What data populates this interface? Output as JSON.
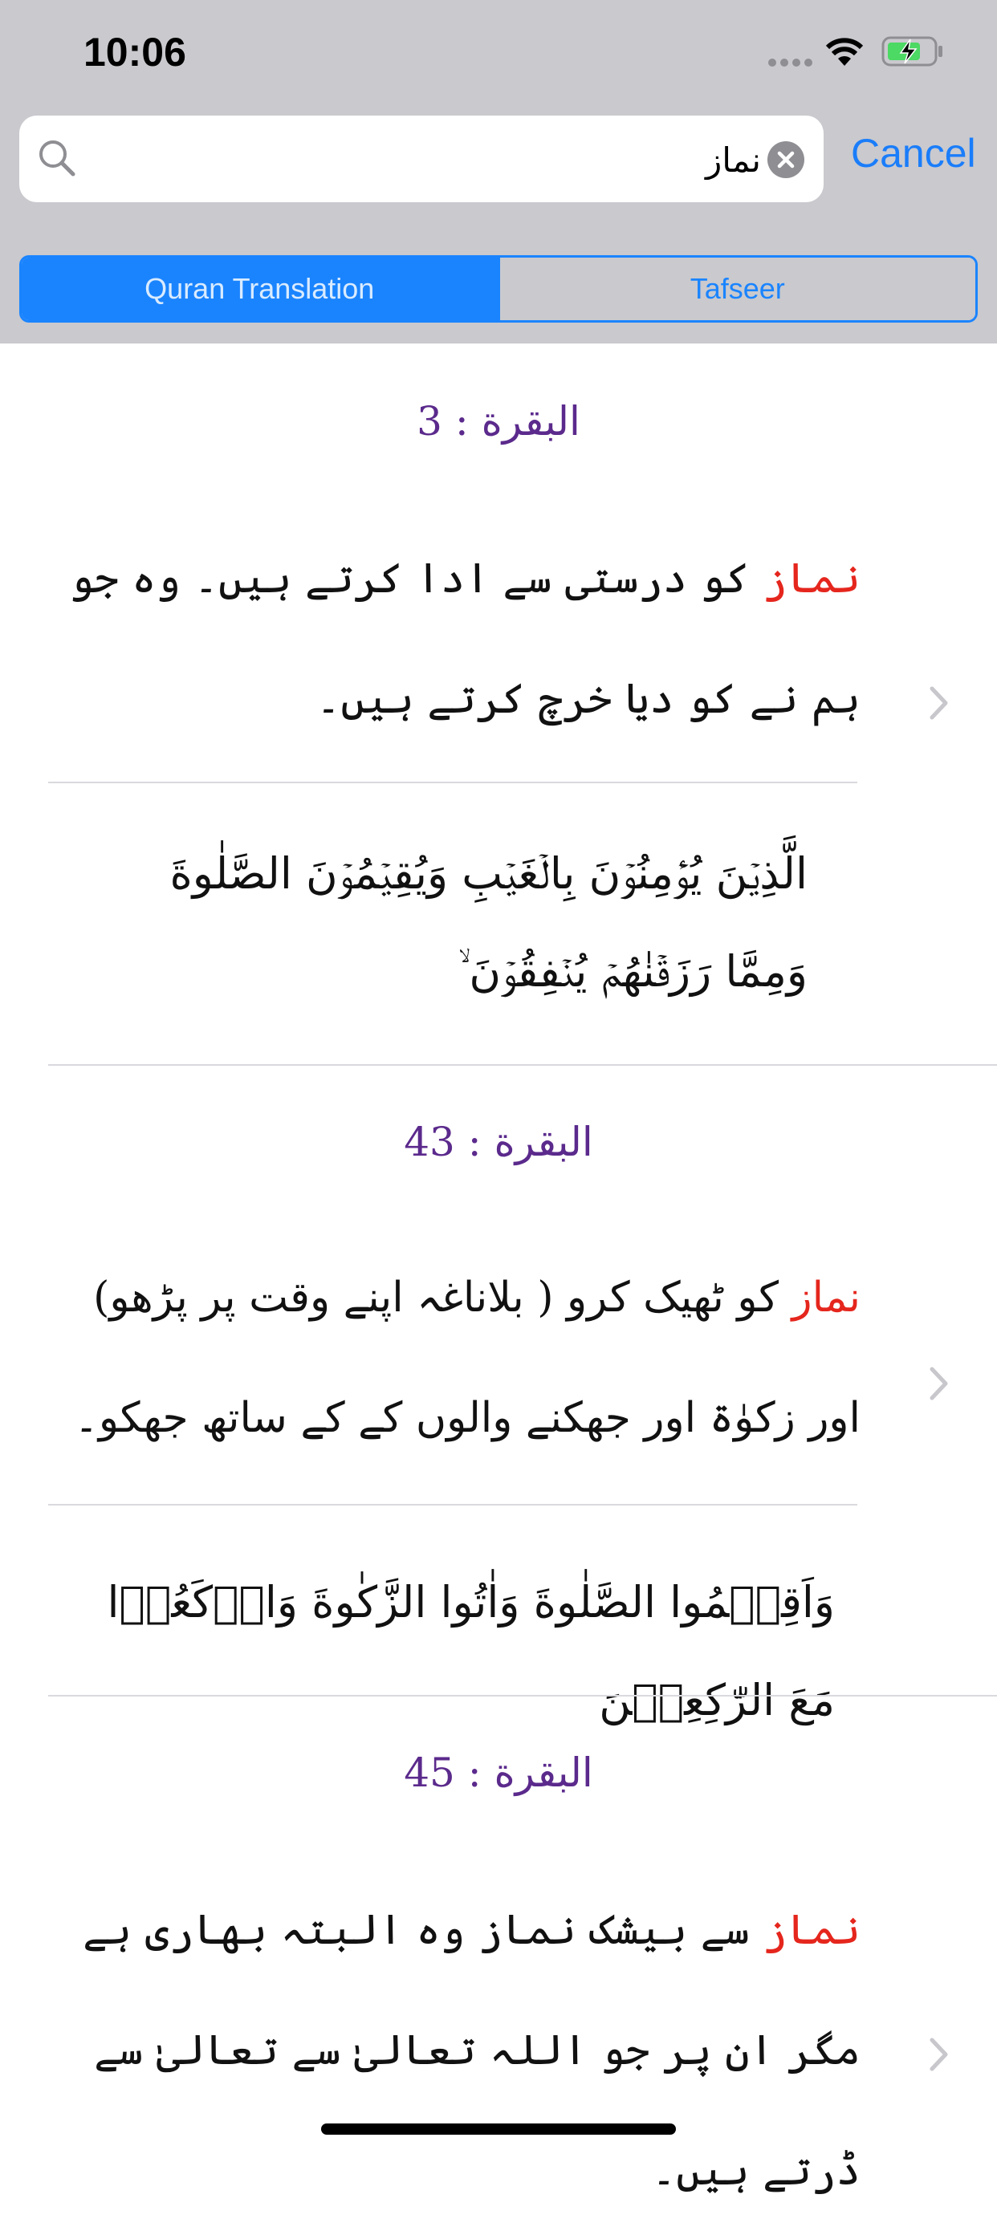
{
  "status_bar": {
    "time": "10:06"
  },
  "search": {
    "query": "نماز",
    "cancel_label": "Cancel"
  },
  "segments": [
    {
      "label": "Quran Translation",
      "selected": true
    },
    {
      "label": "Tafseer",
      "selected": false
    }
  ],
  "results": [
    {
      "reference": "البقرة : 3",
      "highlight": "نماز",
      "translation_rest": " کو درستی سے ادا کرتے ہیں۔ وہ جو ہم نے کو دیا خرچ کرتے ہیں۔",
      "arabic": "الَّذِيۡنَ يُؤۡمِنُوۡنَ بِالۡغَيۡبِ وَيُقِيۡمُوۡنَ الصَّلٰوةَ وَمِمَّا رَزَقۡنٰهُمۡ يُنۡفِقُوۡنَ ۙ"
    },
    {
      "reference": "البقرة : 43",
      "highlight": "نماز",
      "translation_rest": " کو ٹھیک کرو ( بلاناغہ اپنے وقت پر پڑھو) اور زکوٰۃ اور جھکنے والوں کے کے ساتھ جھکو۔",
      "arabic": "وَاَقِيۡمُوا الصَّلٰوةَ وَاٰتُوا الزَّکٰوةَ وَارۡکَعُوۡا مَعَ الرّٰكِعِيۡنَ"
    },
    {
      "reference": "البقرة : 45",
      "highlight": "نماز",
      "translation_rest": " سے بیشک نماز وہ البتہ بھاری ہے مگر ان پر جو اللہ تعالیٰ سے تعالیٰ سے ڈرتے ہیں۔",
      "arabic": ""
    }
  ],
  "colors": {
    "accent": "#1a84ff",
    "reference": "#5b2a8c",
    "highlight": "#e5261d",
    "header_bg": "#c9c9ce"
  },
  "icons": [
    "signal-icon",
    "wifi-icon",
    "battery-charging-icon",
    "search-icon",
    "clear-icon",
    "chevron-right-icon"
  ]
}
